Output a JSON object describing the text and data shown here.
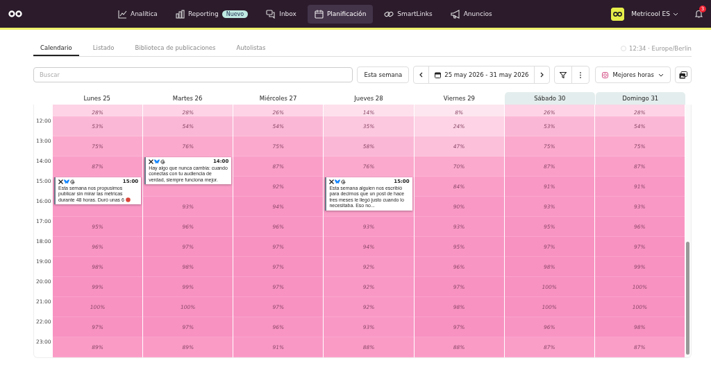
{
  "nav": {
    "items": [
      {
        "label": "Analítica",
        "selected": false
      },
      {
        "label": "Reporting",
        "selected": false,
        "badge": "Nuevo"
      },
      {
        "label": "Inbox",
        "selected": false
      },
      {
        "label": "Planificación",
        "selected": true
      },
      {
        "label": "SmartLinks",
        "selected": false
      },
      {
        "label": "Anuncios",
        "selected": false
      }
    ],
    "account": "Metricool ES",
    "notifications": "3"
  },
  "tabs": [
    {
      "label": "Calendario",
      "selected": true
    },
    {
      "label": "Listado",
      "selected": false
    },
    {
      "label": "Biblioteca de publicaciones",
      "selected": false
    },
    {
      "label": "Autolistas",
      "selected": false
    }
  ],
  "timezone": "12:34 · Europe/Berlin",
  "toolbar": {
    "search": {
      "placeholder": "Buscar"
    },
    "this_week": "Esta semana",
    "date_range": "25 may 2026 - 31 may 2026",
    "best_times": "Mejores horas"
  },
  "calendar": {
    "hours": [
      "12:00",
      "13:00",
      "14:00",
      "15:00",
      "16:00",
      "17:00",
      "18:00",
      "19:00",
      "20:00",
      "21:00",
      "22:00",
      "23:00"
    ],
    "days": [
      {
        "label": "Lunes 25",
        "weekend": false,
        "cells": [
          {
            "text": "28%",
            "color": "#fdd3e5"
          },
          {
            "text": "53%",
            "color": "#fbb8d6"
          },
          {
            "text": "75%",
            "color": "#fba9cd"
          },
          {
            "text": "87%",
            "color": "#fa9ec8"
          },
          {
            "color": "#f998c5",
            "post": {
              "time": "15:00",
              "text": "Esta semana nos propusimos publicar sin mirar las métricas durante 48 horas. Duró unas 6",
              "emoji": true
            }
          },
          {
            "text": "95%",
            "color": "#f995c3"
          },
          {
            "text": "96%",
            "color": "#f995c3"
          },
          {
            "text": "98%",
            "color": "#f892c1"
          },
          {
            "text": "99%",
            "color": "#f892c1"
          },
          {
            "text": "100%",
            "color": "#f892c1"
          },
          {
            "text": "97%",
            "color": "#f892c1"
          },
          {
            "text": "89%",
            "color": "#fa9bc6"
          }
        ]
      },
      {
        "label": "Martes 26",
        "weekend": false,
        "cells": [
          {
            "text": "28%",
            "color": "#fdd3e5"
          },
          {
            "text": "54%",
            "color": "#fbb8d6"
          },
          {
            "text": "76%",
            "color": "#fba9cd"
          },
          {
            "color": "#fa9ec8",
            "post": {
              "time": "14:00",
              "text": "Hay algo que nunca cambia: cuando conectas con tu audiencia de verdad, siempre funciona mejor.",
              "emoji": false
            }
          },
          {
            "text": "93%",
            "color": "#f998c5"
          },
          {
            "text": "96%",
            "color": "#f995c3"
          },
          {
            "text": "97%",
            "color": "#f892c1"
          },
          {
            "text": "98%",
            "color": "#f892c1"
          },
          {
            "text": "99%",
            "color": "#f892c1"
          },
          {
            "text": "100%",
            "color": "#f892c1"
          },
          {
            "text": "97%",
            "color": "#f892c1"
          },
          {
            "text": "89%",
            "color": "#fa9bc6"
          }
        ]
      },
      {
        "label": "Miércoles 27",
        "weekend": false,
        "cells": [
          {
            "text": "26%",
            "color": "#fdd3e5"
          },
          {
            "text": "54%",
            "color": "#fbb8d6"
          },
          {
            "text": "75%",
            "color": "#fba9cd"
          },
          {
            "text": "87%",
            "color": "#fa9ec8"
          },
          {
            "text": "92%",
            "color": "#f998c5"
          },
          {
            "text": "94%",
            "color": "#f995c3"
          },
          {
            "text": "96%",
            "color": "#f995c3"
          },
          {
            "text": "97%",
            "color": "#f892c1"
          },
          {
            "text": "97%",
            "color": "#f892c1"
          },
          {
            "text": "97%",
            "color": "#f892c1"
          },
          {
            "text": "97%",
            "color": "#f892c1"
          },
          {
            "text": "96%",
            "color": "#f995c3"
          },
          {
            "text": "91%",
            "color": "#f998c5"
          }
        ]
      },
      {
        "label": "Jueves 28",
        "weekend": false,
        "cells": [
          {
            "text": "14%",
            "color": "#fde0ec"
          },
          {
            "text": "35%",
            "color": "#fcc8df"
          },
          {
            "text": "58%",
            "color": "#fbb8d6"
          },
          {
            "text": "76%",
            "color": "#fba9cd"
          },
          {
            "color": "#fa9ec8",
            "post": {
              "time": "15:00",
              "text": "Esta semana alguien nos escribió para decirnos que un post de hace tres meses le llegó justo cuando lo necesitaba. Eso no...",
              "emoji": false
            }
          },
          {
            "text": "93%",
            "color": "#f998c5"
          },
          {
            "text": "94%",
            "color": "#f995c3"
          },
          {
            "text": "92%",
            "color": "#f998c5"
          },
          {
            "text": "92%",
            "color": "#f998c5"
          },
          {
            "text": "92%",
            "color": "#f998c5"
          },
          {
            "text": "93%",
            "color": "#f998c5"
          },
          {
            "text": "88%",
            "color": "#fa9bc6"
          }
        ]
      },
      {
        "label": "Viernes 29",
        "weekend": false,
        "cells": [
          {
            "text": "8%",
            "color": "#fde6ef"
          },
          {
            "text": "24%",
            "color": "#fdd3e5"
          },
          {
            "text": "47%",
            "color": "#fcc0db"
          },
          {
            "text": "70%",
            "color": "#fba9cd"
          },
          {
            "text": "84%",
            "color": "#fa9ec8"
          },
          {
            "text": "90%",
            "color": "#f998c5"
          },
          {
            "text": "93%",
            "color": "#f998c5"
          },
          {
            "text": "95%",
            "color": "#f995c3"
          },
          {
            "text": "96%",
            "color": "#f995c3"
          },
          {
            "text": "97%",
            "color": "#f892c1"
          },
          {
            "text": "98%",
            "color": "#f892c1"
          },
          {
            "text": "97%",
            "color": "#f892c1"
          },
          {
            "text": "88%",
            "color": "#fa9bc6"
          }
        ]
      },
      {
        "label": "Sábado 30",
        "weekend": true,
        "cells": [
          {
            "text": "26%",
            "color": "#fdd3e5"
          },
          {
            "text": "53%",
            "color": "#fbb8d6"
          },
          {
            "text": "75%",
            "color": "#fba9cd"
          },
          {
            "text": "87%",
            "color": "#fa9ec8"
          },
          {
            "text": "91%",
            "color": "#f998c5"
          },
          {
            "text": "93%",
            "color": "#f998c5"
          },
          {
            "text": "95%",
            "color": "#f995c3"
          },
          {
            "text": "97%",
            "color": "#f892c1"
          },
          {
            "text": "98%",
            "color": "#f892c1"
          },
          {
            "text": "100%",
            "color": "#f892c1"
          },
          {
            "text": "100%",
            "color": "#f892c1"
          },
          {
            "text": "96%",
            "color": "#f995c3"
          },
          {
            "text": "87%",
            "color": "#fa9ec8"
          }
        ]
      },
      {
        "label": "Domingo 31",
        "weekend": true,
        "cells": [
          {
            "text": "28%",
            "color": "#fdd3e5"
          },
          {
            "text": "54%",
            "color": "#fbb8d6"
          },
          {
            "text": "75%",
            "color": "#fba9cd"
          },
          {
            "text": "87%",
            "color": "#fa9ec8"
          },
          {
            "text": "91%",
            "color": "#f998c5"
          },
          {
            "text": "93%",
            "color": "#f998c5"
          },
          {
            "text": "96%",
            "color": "#f995c3"
          },
          {
            "text": "97%",
            "color": "#f892c1"
          },
          {
            "text": "99%",
            "color": "#f892c1"
          },
          {
            "text": "100%",
            "color": "#f892c1"
          },
          {
            "text": "100%",
            "color": "#f892c1"
          },
          {
            "text": "98%",
            "color": "#f892c1"
          },
          {
            "text": "87%",
            "color": "#fa9ec8"
          }
        ]
      }
    ]
  }
}
